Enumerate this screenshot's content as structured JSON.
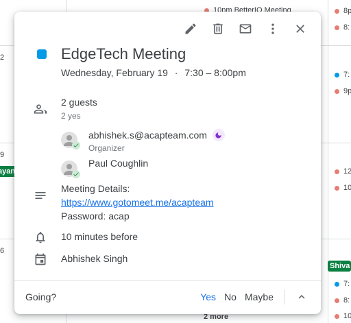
{
  "background": {
    "day_numbers": [
      "2",
      "9",
      "6"
    ],
    "events": [
      {
        "text": "10pm BetterIO Meeting",
        "color": "#e67c73"
      },
      {
        "text": "8p",
        "color": "#e67c73"
      },
      {
        "text": "8:",
        "color": "#e67c73"
      },
      {
        "text": "7:",
        "color": "#039be5"
      },
      {
        "text": "9p",
        "color": "#e67c73"
      },
      {
        "text": "12",
        "color": "#e67c73"
      },
      {
        "text": "10",
        "color": "#e67c73"
      },
      {
        "text": "7:",
        "color": "#039be5"
      },
      {
        "text": "8:",
        "color": "#e67c73"
      },
      {
        "text": "10",
        "color": "#e67c73"
      }
    ],
    "chips": [
      "ayan",
      "Shiva"
    ],
    "more_label": "2 more"
  },
  "event": {
    "color": "#039be5",
    "title": "EdgeTech Meeting",
    "date": "Wednesday, February 19",
    "time_sep": "·",
    "time": "7:30 – 8:00pm"
  },
  "guests": {
    "count_label": "2 guests",
    "summary": "2 yes",
    "list": [
      {
        "name": "abhishek.s@acapteam.com",
        "role": "Organizer"
      },
      {
        "name": "Paul Coughlin",
        "role": ""
      }
    ]
  },
  "description": {
    "line1": "Meeting Details:",
    "link": "https://www.gotomeet.me/acapteam",
    "line3": "Password: acap"
  },
  "reminder": "10 minutes before",
  "calendar_owner": "Abhishek Singh",
  "footer": {
    "going_label": "Going?",
    "yes": "Yes",
    "no": "No",
    "maybe": "Maybe"
  },
  "toolbar_icons": [
    "edit-icon",
    "delete-icon",
    "email-icon",
    "more-vert-icon",
    "close-icon"
  ]
}
